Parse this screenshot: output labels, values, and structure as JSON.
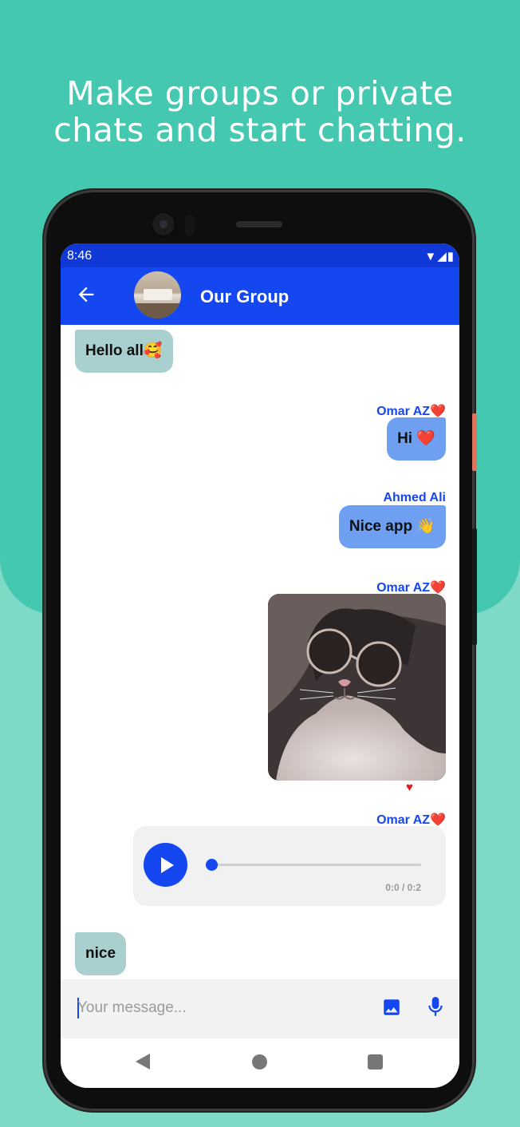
{
  "headline": {
    "line1": "Make groups or private",
    "line2": "chats and start chatting."
  },
  "status_bar": {
    "time": "8:46",
    "icons": [
      "wifi-icon",
      "signal-icon",
      "battery-icon"
    ]
  },
  "app_bar": {
    "title": "Our Group",
    "back_icon": "arrow-left-icon",
    "avatar": "group-avatar-photo"
  },
  "messages": [
    {
      "type": "text",
      "side": "left",
      "text": "Hello all🥰"
    },
    {
      "type": "text",
      "side": "right",
      "sender": "Omar AZ❤️",
      "text": "Hi ❤️"
    },
    {
      "type": "text",
      "side": "right",
      "sender": "Ahmed Ali",
      "text": "Nice app 👋"
    },
    {
      "type": "image",
      "side": "right",
      "sender": "Omar AZ❤️",
      "image": "cat-with-sunglasses-photo",
      "reaction": "♥"
    },
    {
      "type": "audio",
      "side": "right",
      "sender": "Omar AZ❤️",
      "time": "0:0 / 0:2",
      "progress": 0
    },
    {
      "type": "text",
      "side": "left",
      "text": "nice"
    }
  ],
  "input": {
    "placeholder": "Your message...",
    "value": "",
    "icons": [
      "image-icon",
      "microphone-icon"
    ]
  },
  "nav_bar": {
    "icons": [
      "nav-back-icon",
      "nav-home-icon",
      "nav-recents-icon"
    ]
  },
  "colors": {
    "background_top": "#44c9b0",
    "background_bottom": "#7fd9c7",
    "brand_blue": "#1447ef",
    "bubble_left": "#a9cfcf",
    "bubble_right": "#6e9ff0"
  }
}
